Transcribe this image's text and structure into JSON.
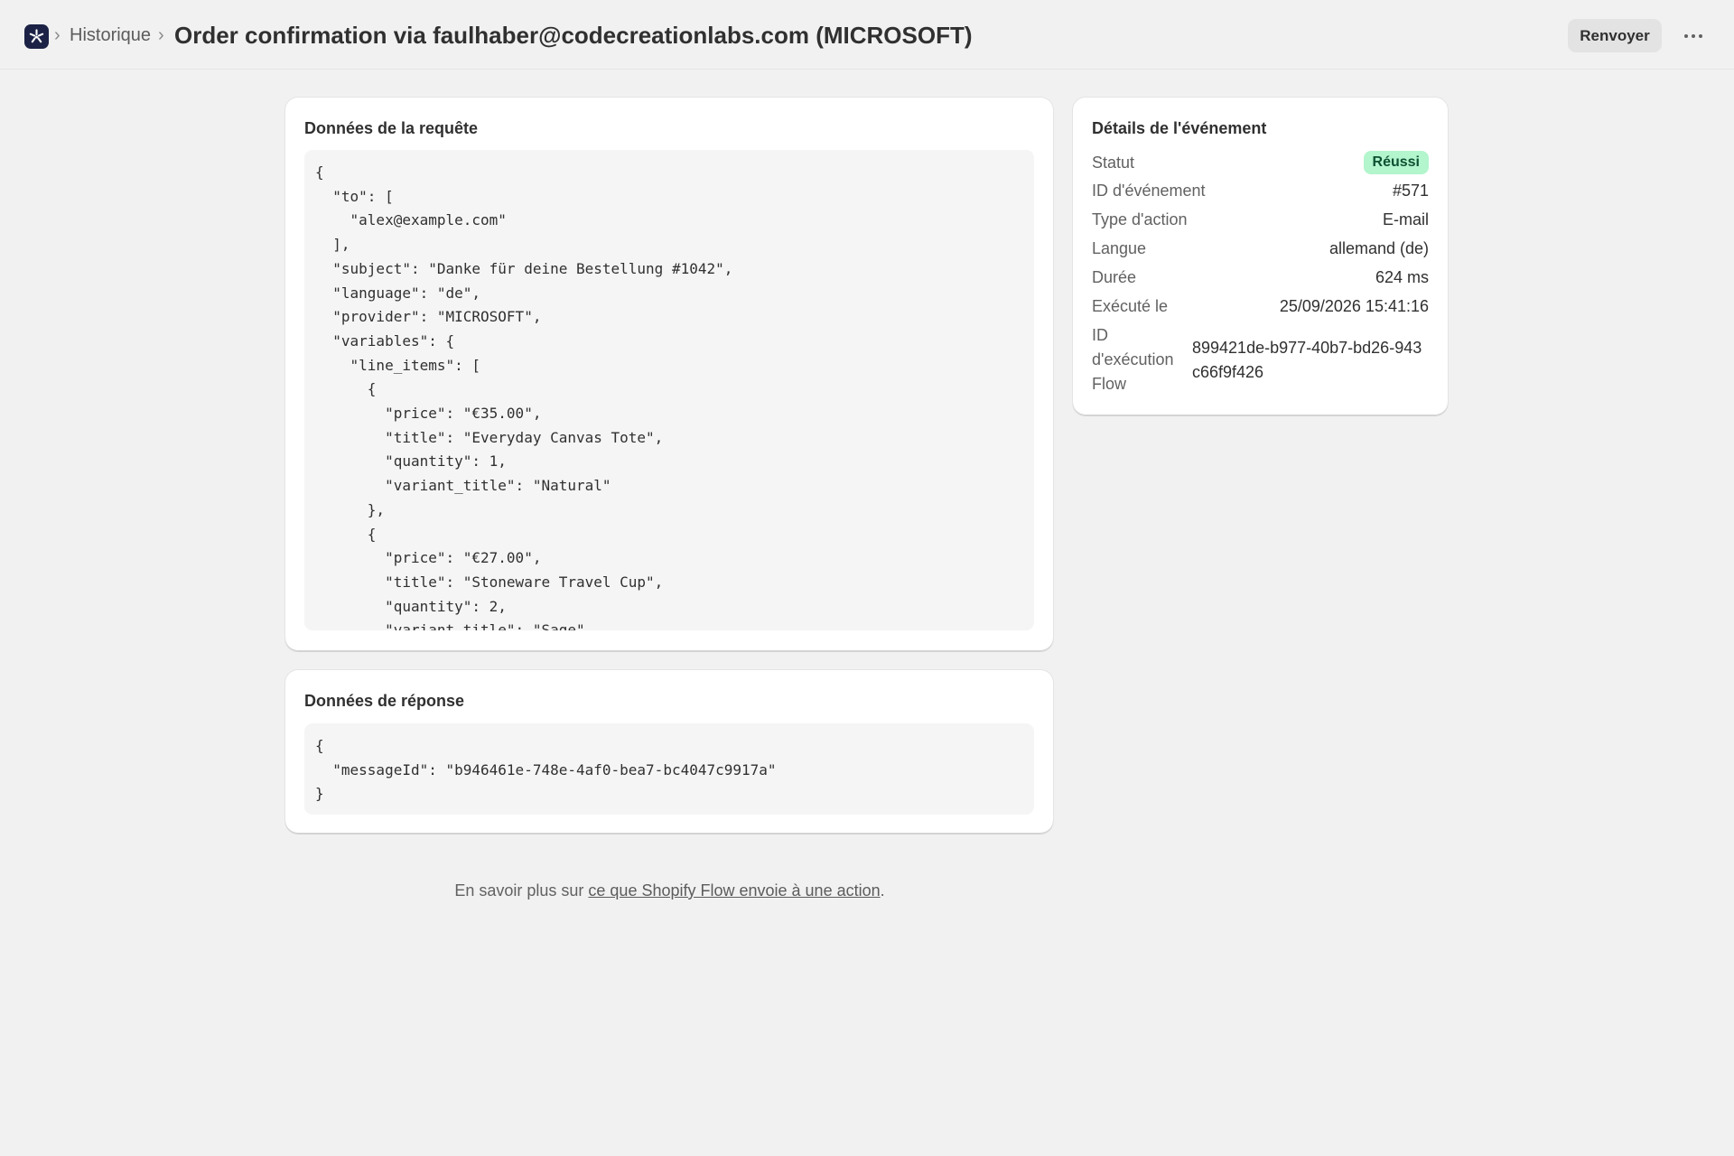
{
  "header": {
    "breadcrumb_separator": "›",
    "breadcrumb_history": "Historique",
    "title": "Order confirmation via faulhaber@codecreationlabs.com (MICROSOFT)",
    "resend_label": "Renvoyer",
    "more_icon": "more-horizontal-icon",
    "app_icon": "flow-app-icon"
  },
  "request": {
    "title": "Données de la requête",
    "code": "{\n  \"to\": [\n    \"alex@example.com\"\n  ],\n  \"subject\": \"Danke für deine Bestellung #1042\",\n  \"language\": \"de\",\n  \"provider\": \"MICROSOFT\",\n  \"variables\": {\n    \"line_items\": [\n      {\n        \"price\": \"€35.00\",\n        \"title\": \"Everyday Canvas Tote\",\n        \"quantity\": 1,\n        \"variant_title\": \"Natural\"\n      },\n      {\n        \"price\": \"€27.00\",\n        \"title\": \"Stoneware Travel Cup\",\n        \"quantity\": 2,\n        \"variant_title\": \"Sage\"\n      }"
  },
  "response": {
    "title": "Données de réponse",
    "code": "{\n  \"messageId\": \"b946461e-748e-4af0-bea7-bc4047c9917a\"\n}"
  },
  "details": {
    "title": "Détails de l'événement",
    "status_label": "Statut",
    "status_value": "Réussi",
    "event_id_label": "ID d'événement",
    "event_id_value": "#571",
    "action_type_label": "Type d'action",
    "action_type_value": "E-mail",
    "language_label": "Langue",
    "language_value": "allemand (de)",
    "duration_label": "Durée",
    "duration_value": "624 ms",
    "executed_label": "Exécuté le",
    "executed_value": "25/09/2026 15:41:16",
    "flow_exec_label": "ID d'exécution Flow",
    "flow_exec_value": "899421de-b977-40b7-bd26-943c66f9f426"
  },
  "footer": {
    "prefix": "En savoir plus sur ",
    "link": "ce que Shopify Flow envoie à une action",
    "suffix": "."
  },
  "colors": {
    "background": "#f1f1f1",
    "card": "#ffffff",
    "badge_success_bg": "#b3f5cd",
    "badge_success_text": "#0c5132",
    "app_icon_bg": "#1b2245"
  }
}
